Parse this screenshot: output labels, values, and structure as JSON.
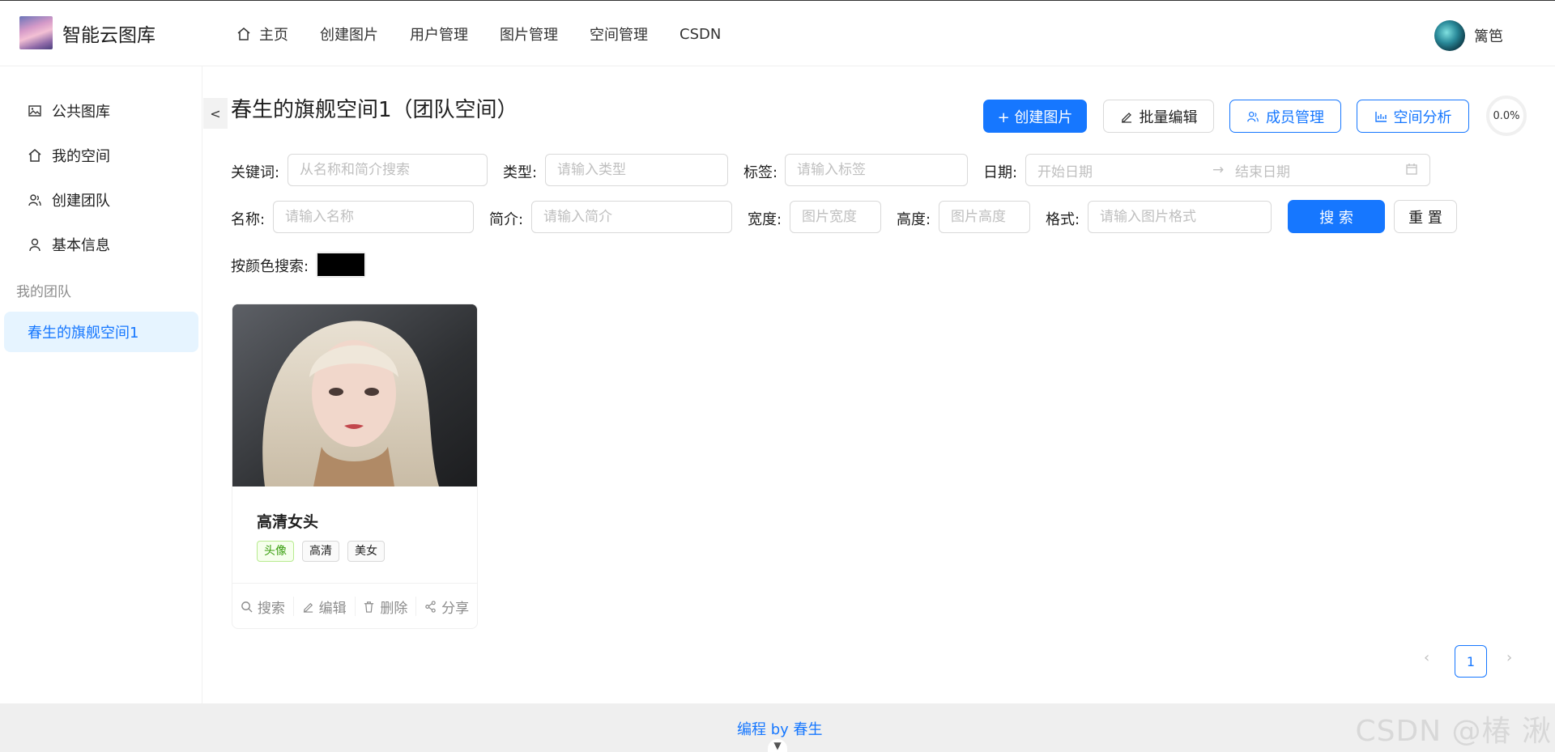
{
  "header": {
    "brand": "智能云图库",
    "nav": [
      {
        "label": "主页",
        "icon": "home-icon"
      },
      {
        "label": "创建图片"
      },
      {
        "label": "用户管理"
      },
      {
        "label": "图片管理"
      },
      {
        "label": "空间管理"
      },
      {
        "label": "CSDN"
      }
    ],
    "user_name": "篱笆"
  },
  "sidebar": {
    "items": [
      {
        "label": "公共图库",
        "icon": "picture-icon"
      },
      {
        "label": "我的空间",
        "icon": "home-icon"
      },
      {
        "label": "创建团队",
        "icon": "team-icon"
      },
      {
        "label": "基本信息",
        "icon": "user-icon"
      }
    ],
    "group_label": "我的团队",
    "team_items": [
      {
        "label": "春生的旗舰空间1",
        "active": true
      }
    ]
  },
  "main": {
    "collapse_label": "<",
    "title": "春生的旗舰空间1（团队空间）",
    "actions": {
      "create": "+ 创建图片",
      "batch_edit": "批量编辑",
      "members": "成员管理",
      "analysis": "空间分析",
      "usage": "0.0%"
    },
    "filters": {
      "keyword_label": "关键词:",
      "keyword_placeholder": "从名称和简介搜索",
      "category_label": "类型:",
      "category_placeholder": "请输入类型",
      "tags_label": "标签:",
      "tags_placeholder": "请输入标签",
      "date_label": "日期:",
      "date_start": "开始日期",
      "date_end": "结束日期",
      "name_label": "名称:",
      "name_placeholder": "请输入名称",
      "intro_label": "简介:",
      "intro_placeholder": "请输入简介",
      "width_label": "宽度:",
      "width_placeholder": "图片宽度",
      "height_label": "高度:",
      "height_placeholder": "图片高度",
      "format_label": "格式:",
      "format_placeholder": "请输入图片格式",
      "search_button": "搜 索",
      "reset_button": "重 置",
      "color_label": "按颜色搜索:",
      "color_value": "#000000"
    },
    "pictures": [
      {
        "title": "高清女头",
        "tags": [
          "头像",
          "高清",
          "美女"
        ],
        "actions": [
          "搜索",
          "编辑",
          "删除",
          "分享"
        ]
      }
    ],
    "pagination": {
      "current": "1",
      "prev": "‹",
      "next": "›"
    }
  },
  "footer": {
    "text": "编程 by 春生",
    "handle": "▼",
    "watermark": "CSDN @椿  湫"
  }
}
